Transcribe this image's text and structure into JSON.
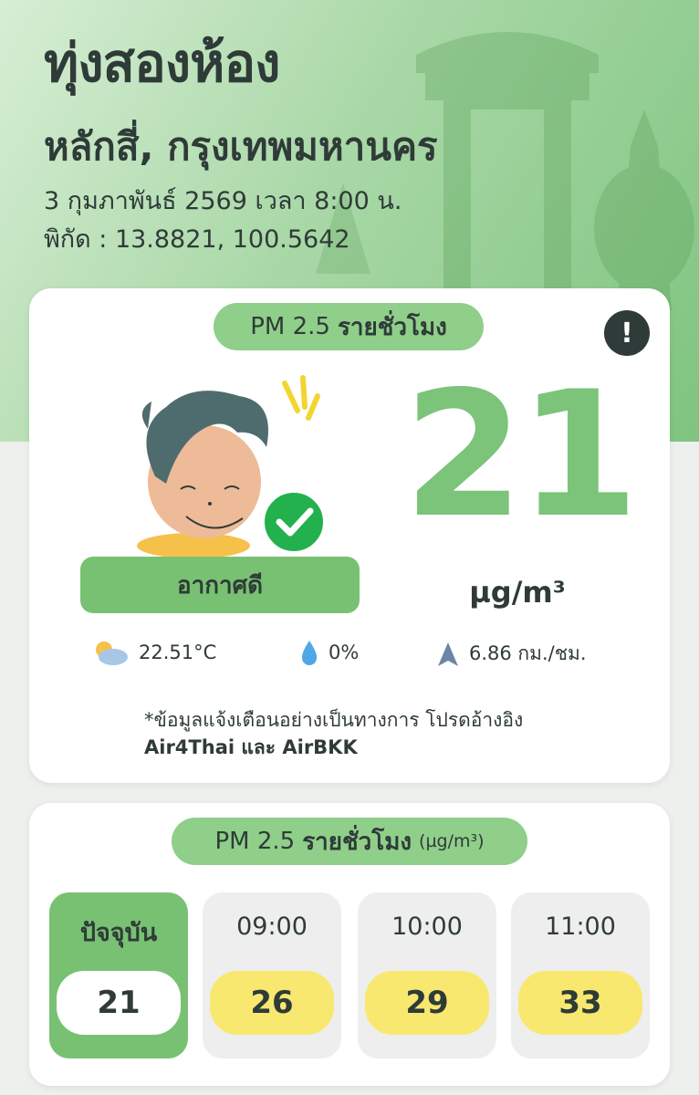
{
  "location": {
    "district": "ทุ่งสองห้อง",
    "area": "หลักสี่, กรุงเทพมหานคร",
    "datetime": "3 กุมภาพันธ์ 2569  เวลา 8:00 น.",
    "coordinates": "พิกัด : 13.8821, 100.5642"
  },
  "current_card": {
    "header_prefix": "PM 2.5",
    "header_bold": "รายชั่วโมง",
    "alert_icon": "exclamation-icon",
    "status_label": "อากาศดี",
    "pm_value": "21",
    "pm_unit": "µg/m³",
    "weather": {
      "temperature": "22.51°C",
      "rain": "0%",
      "wind": "6.86 กม./ชม."
    },
    "disclaimer_line1": "*ข้อมูลแจ้งเตือนอย่างเป็นทางการ โปรดอ้างอิง",
    "disclaimer_line2": "Air4Thai และ AirBKK"
  },
  "hourly_card": {
    "header_prefix": "PM 2.5",
    "header_bold": "รายชั่วโมง",
    "header_unit": "(µg/m³)",
    "tiles": [
      {
        "label": "ปัจจุบัน",
        "value": "21"
      },
      {
        "label": "09:00",
        "value": "26"
      },
      {
        "label": "10:00",
        "value": "29"
      },
      {
        "label": "11:00",
        "value": "33"
      }
    ]
  },
  "colors": {
    "good_green": "#78c173",
    "pm_value_green": "#7bc47a",
    "moderate_yellow": "#f8e86f",
    "text_dark": "#2f3b38"
  }
}
